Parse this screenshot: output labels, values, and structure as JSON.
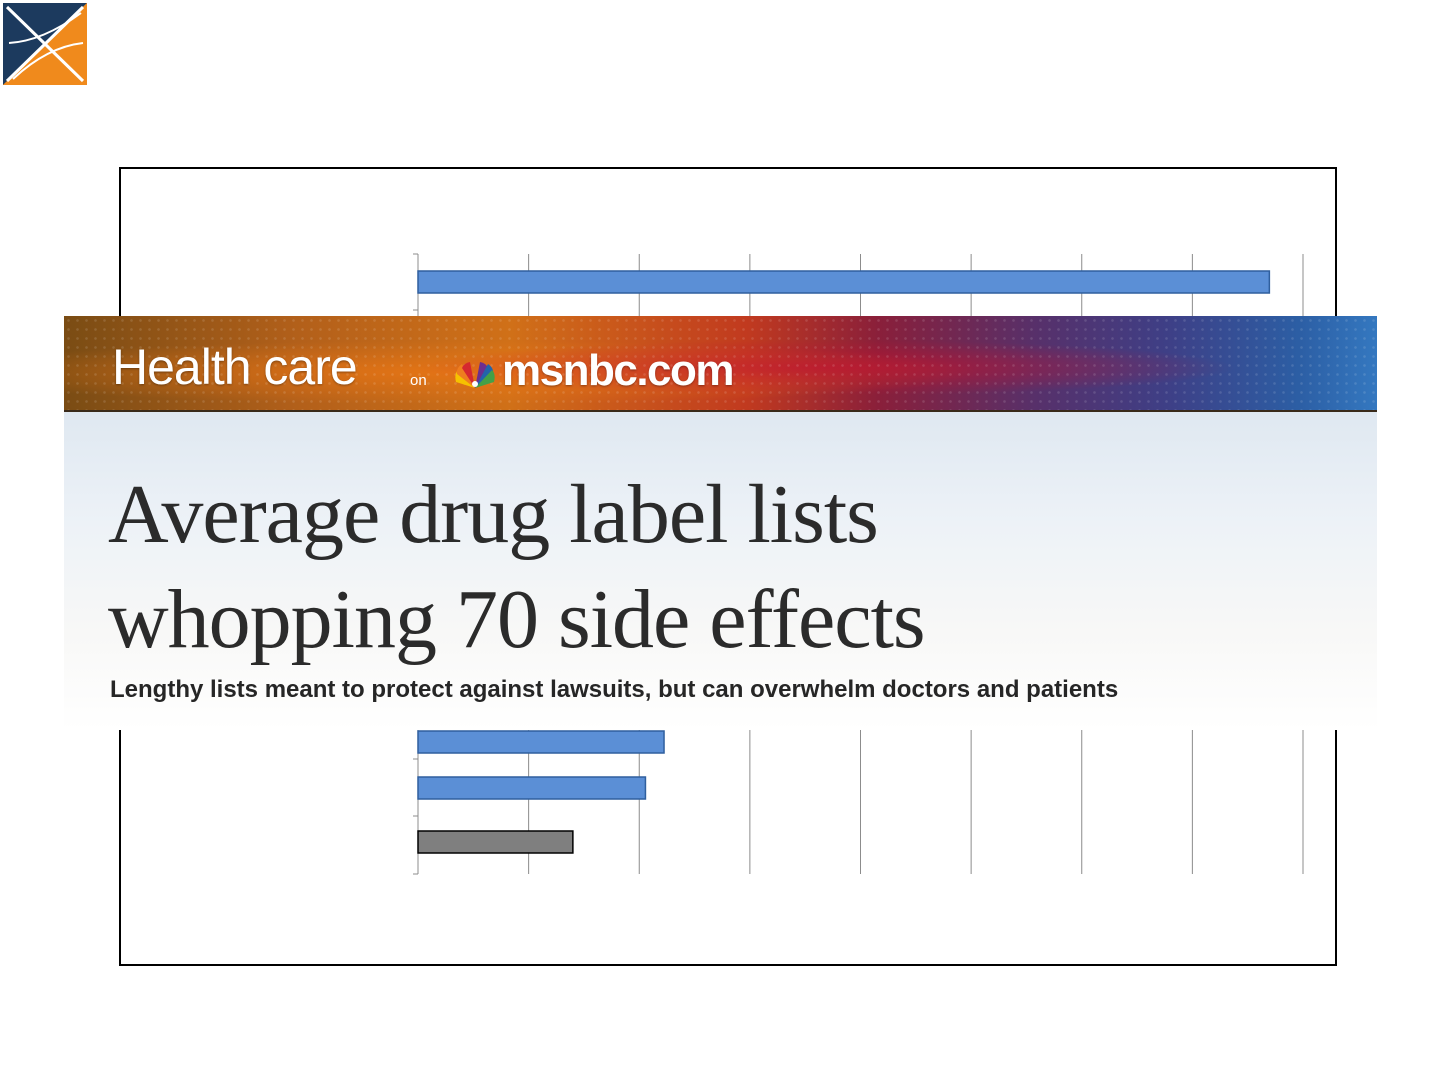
{
  "logo": {
    "icon": "x-cross-logo-icon",
    "colors": [
      "#1c3a5e",
      "#f08a1c",
      "#ffffff"
    ]
  },
  "article": {
    "section": "Health care",
    "on": "on",
    "site": "msnbc.com",
    "headline_line1": "Average drug label lists",
    "headline_line2": "whopping 70 side effects",
    "subhead": "Lengthy lists meant to protect against lawsuits, but can overwhelm doctors and patients"
  },
  "chart_data": {
    "type": "bar",
    "orientation": "horizontal",
    "gridlines": true,
    "bars_visible": [
      {
        "value": 0.962,
        "color": "#5b8fd6"
      },
      {
        "value": 0.278,
        "color": "#5b8fd6"
      },
      {
        "value": 0.257,
        "color": "#5b8fd6"
      },
      {
        "value": 0.175,
        "color": "#7f7f7f"
      }
    ]
  }
}
